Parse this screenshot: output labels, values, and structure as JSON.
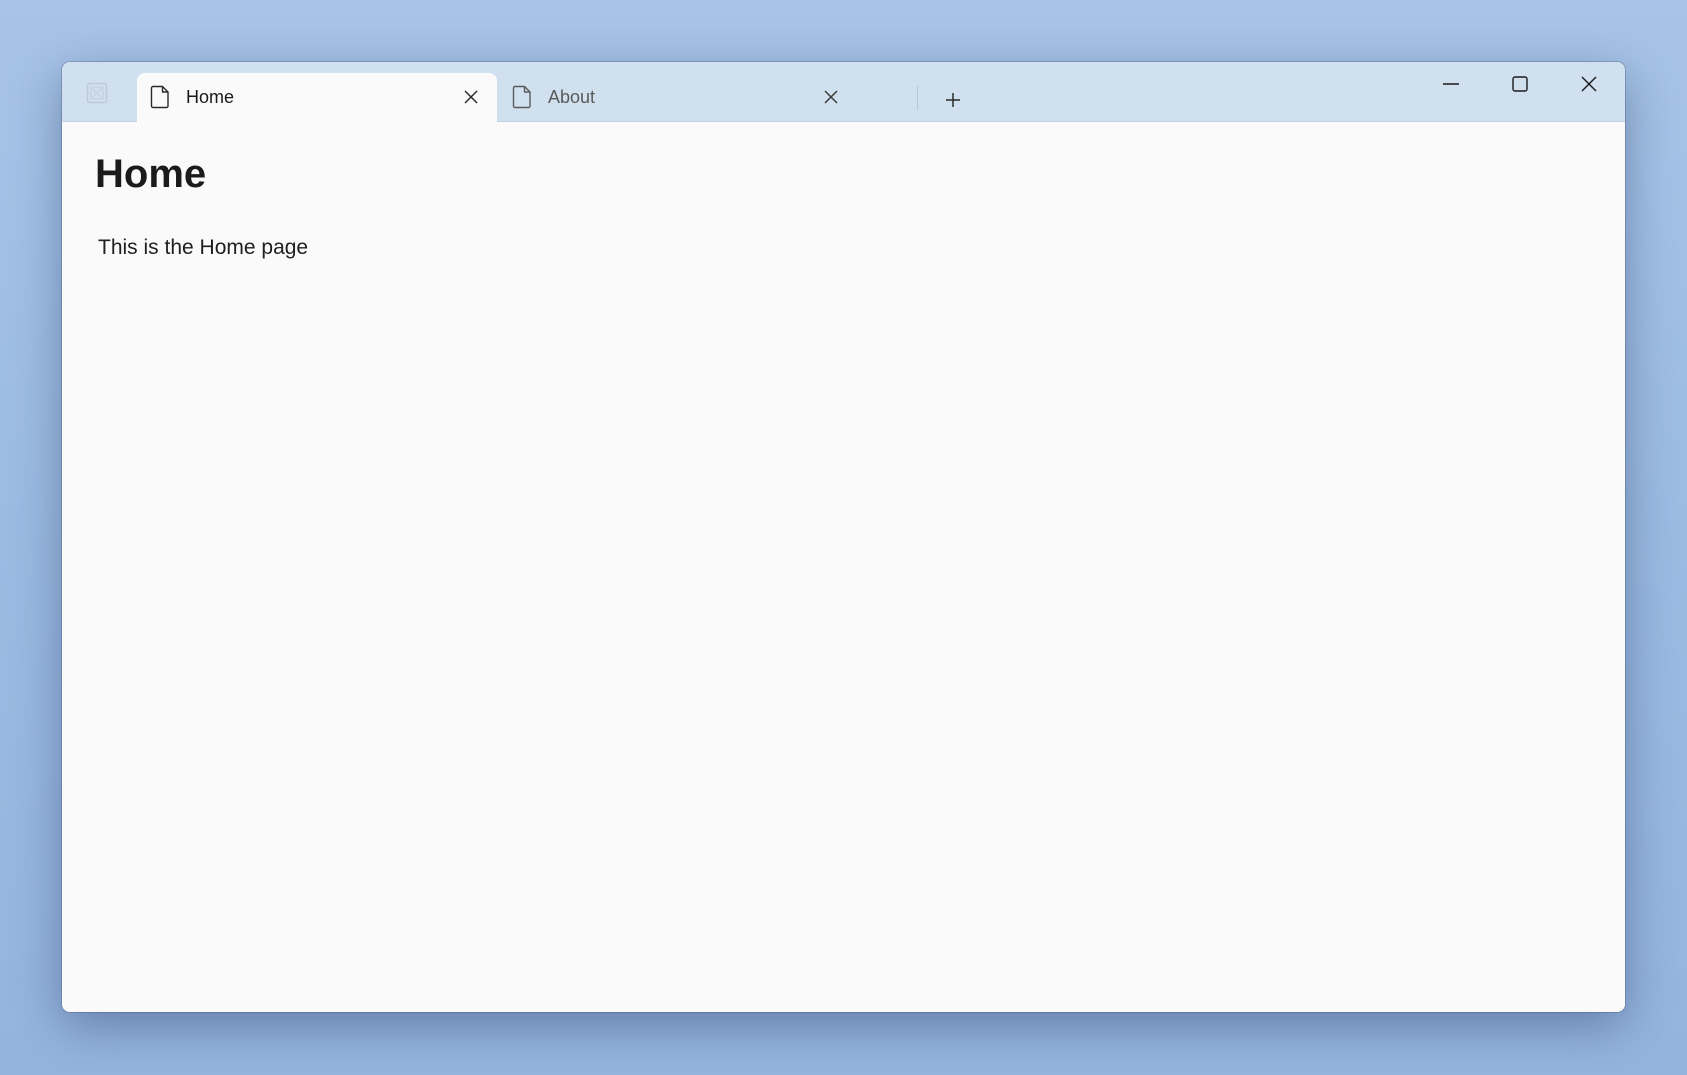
{
  "window": {
    "tabs": [
      {
        "label": "Home",
        "icon": "document-icon",
        "active": true
      },
      {
        "label": "About",
        "icon": "document-icon",
        "active": false
      }
    ],
    "new_tab_icon": "plus-icon",
    "app_icon": "placeholder-app-icon",
    "caption_buttons": [
      "minimize-icon",
      "maximize-icon",
      "close-icon"
    ]
  },
  "content": {
    "title": "Home",
    "body": "This is the Home page"
  },
  "colors": {
    "desktop": "#a3c0e5",
    "titlebar": "#d0e0ee",
    "page": "#fafafa",
    "text": "#1b1b1b"
  }
}
